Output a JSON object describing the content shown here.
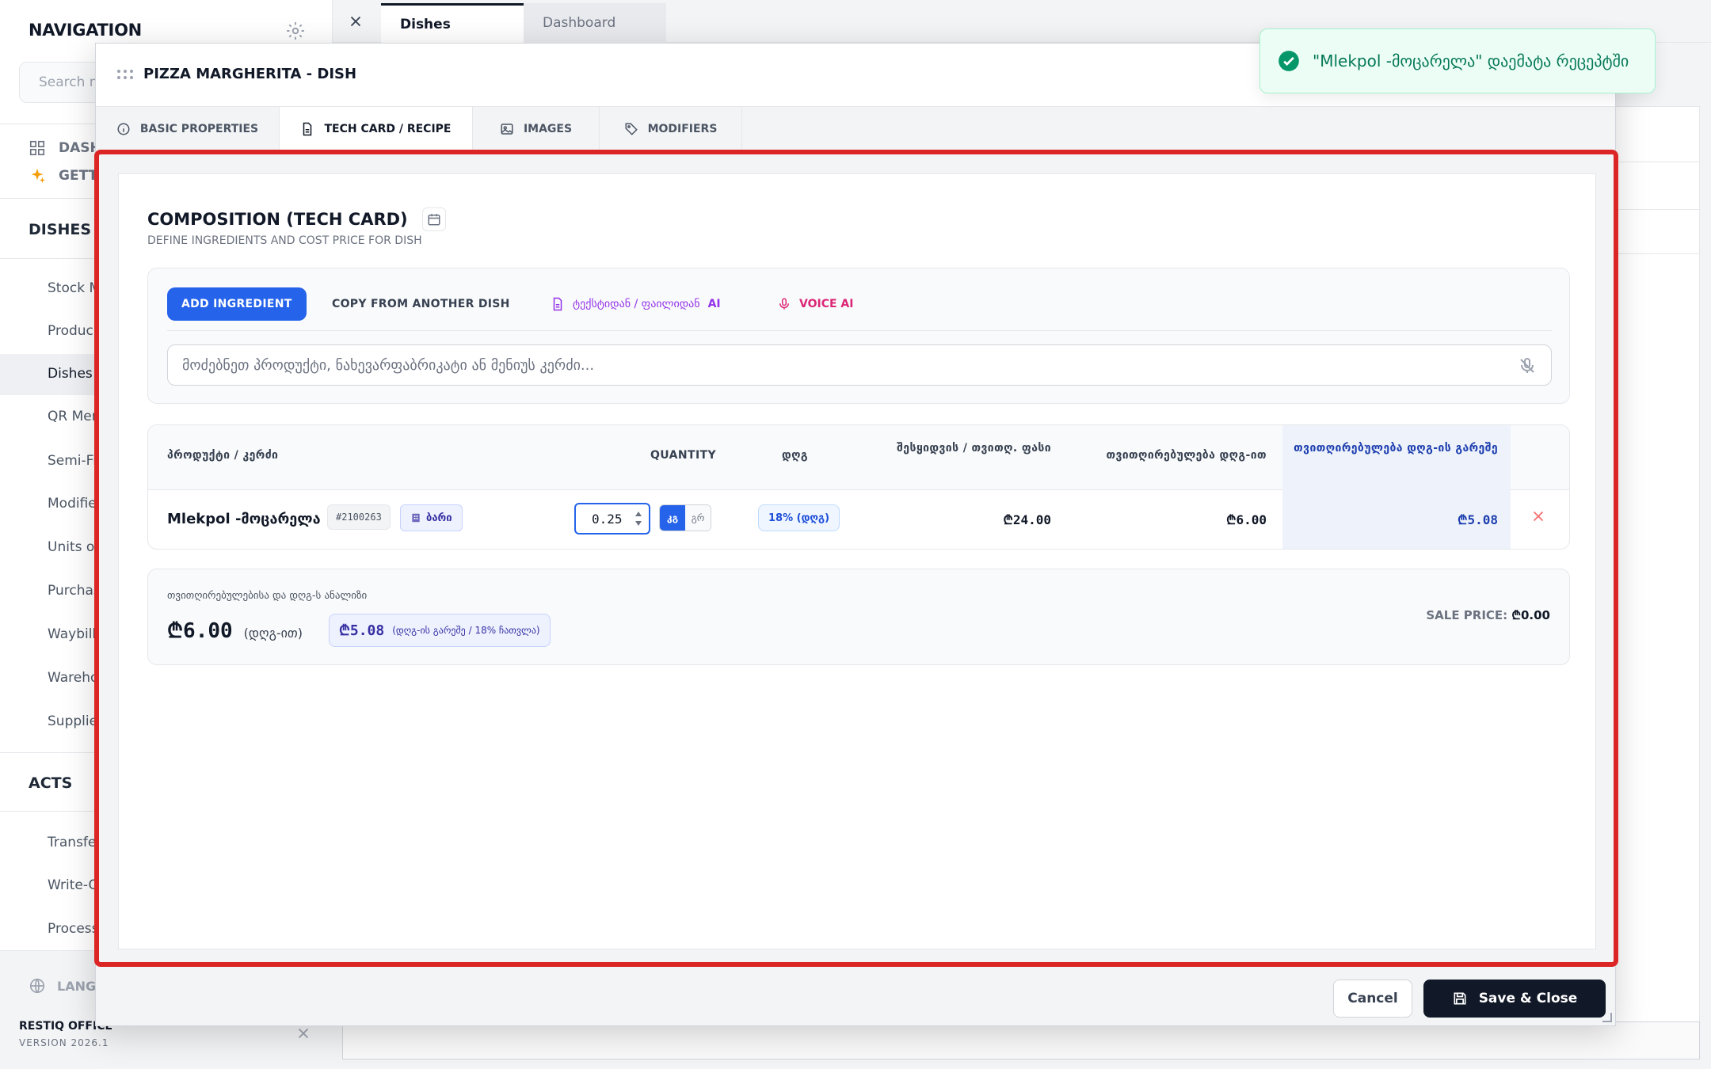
{
  "sidebar": {
    "title": "NAVIGATION",
    "search_placeholder": "Search m",
    "top_items": [
      {
        "label": "DASH",
        "icon": "grid-icon"
      },
      {
        "label": "GETT",
        "icon": "sparkle-icon"
      }
    ],
    "sections": [
      {
        "label": "DISHES &",
        "items": [
          "Stock M",
          "Produc",
          "Dishes",
          "QR Men",
          "Semi-Fi",
          "Modifie",
          "Units o",
          "Purchas",
          "Waybill",
          "Wareho",
          "Supplie"
        ]
      },
      {
        "label": "ACTS",
        "items": [
          "Transfe",
          "Write-O",
          "Process"
        ]
      }
    ],
    "active_item": "Dishes",
    "language_label": "LANGU",
    "brand": "RESTIQ OFFICE",
    "version": "VERSION 2026.1"
  },
  "topbar": {
    "tabs": [
      {
        "label": "Dishes",
        "active": true
      },
      {
        "label": "Dashboard",
        "active": false
      }
    ]
  },
  "modal": {
    "title": "PIZZA MARGHERITA - DISH",
    "tabs": [
      {
        "label": "BASIC PROPERTIES",
        "icon": "info-icon"
      },
      {
        "label": "TECH CARD / RECIPE",
        "icon": "document-icon",
        "active": true
      },
      {
        "label": "IMAGES",
        "icon": "image-icon"
      },
      {
        "label": "MODIFIERS",
        "icon": "tag-icon"
      }
    ],
    "composition": {
      "title": "COMPOSITION (TECH CARD)",
      "subtitle": "DEFINE INGREDIENTS AND COST PRICE FOR DISH",
      "actions": {
        "add": "ADD INGREDIENT",
        "copy": "COPY FROM ANOTHER DISH",
        "ai_text": "ტექსტიდან / ფაილიდან",
        "ai_suffix": "AI",
        "voice": "VOICE AI"
      },
      "search_placeholder": "მოძებნეთ პროდუქტი, ნახევარფაბრიკატი ან მენიუს კერძი...",
      "table": {
        "headers": {
          "product": "პროდუქტი / კერძი",
          "quantity": "QUANTITY",
          "vat": "დღგ",
          "price": "შესყიდვის / თვითღ. ფასი",
          "cost_vat": "თვითღირებულება დღგ-ით",
          "cost_no_vat": "თვითღირებულება დღგ-ის გარეშე"
        },
        "rows": [
          {
            "name": "Mlekpol -მოცარელა",
            "code": "#2100263",
            "store": "ბარი",
            "quantity": "0.25",
            "unit_on": "კგ",
            "unit_off": "გრ",
            "vat": "18% (დღგ)",
            "price": "₾24.00",
            "cost_vat": "₾6.00",
            "cost_no_vat": "₾5.08"
          }
        ]
      },
      "summary": {
        "label": "თვითღირებულებისა და დღგ-ს ანალიზი",
        "total_vat": "₾6.00",
        "total_vat_caption": "(დღგ-ით)",
        "total_no_vat": "₾5.08",
        "total_no_vat_caption": "(დღგ-ის გარეშე / 18% ჩათვლა)",
        "sale_price_label": "SALE PRICE:",
        "sale_price_value": "₾0.00"
      }
    },
    "footer": {
      "cancel": "Cancel",
      "save": "Save & Close"
    }
  },
  "toast": {
    "message": "\"Mlekpol -მოცარელა\" დაემატა რეცეპტში",
    "color": "#047857"
  },
  "colors": {
    "accent": "#2563eb",
    "highlight_frame": "#dc2626",
    "ai_purple": "#9333ea",
    "voice_pink": "#db2777",
    "dark_button": "#111827"
  }
}
